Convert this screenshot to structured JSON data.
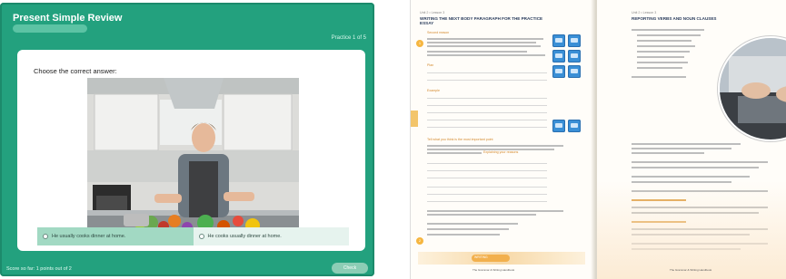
{
  "quiz": {
    "title": "Present Simple Review",
    "subtitle": "",
    "progress": "Practice 1 of 5",
    "question": "Choose the correct answer:",
    "answers": [
      {
        "label": "He usually cooks dinner at home.",
        "selected": true
      },
      {
        "label": "He cooks usually dinner at home.",
        "selected": false
      }
    ],
    "footer": "Score so far: 1 points out of 2",
    "check_label": "Check",
    "colors": {
      "frame": "#23a17e",
      "selected": "#a2d9c3"
    }
  },
  "book": {
    "left_page": {
      "section": "Unit 2 • Lesson 3",
      "heading_1": "WRITING THE NEXT BODY PARAGRAPH FOR THE PRACTICE ESSAY",
      "label_a": "Second reason",
      "label_b": "Plan",
      "label_c": "Tell what you think is the most important point",
      "label_d": "Example",
      "highlight": "Explaining your reasons",
      "badge_1": "1",
      "badge_2": "2",
      "footer_pill": "WRITING",
      "footer_text": "The Grammar & Writing Handbook"
    },
    "right_page": {
      "section": "Unit 2 • Lesson 3",
      "heading_1": "REPORTING VERBS AND NOUN CLAUSES",
      "footer_text": "The Grammar & Writing Handbook"
    }
  }
}
